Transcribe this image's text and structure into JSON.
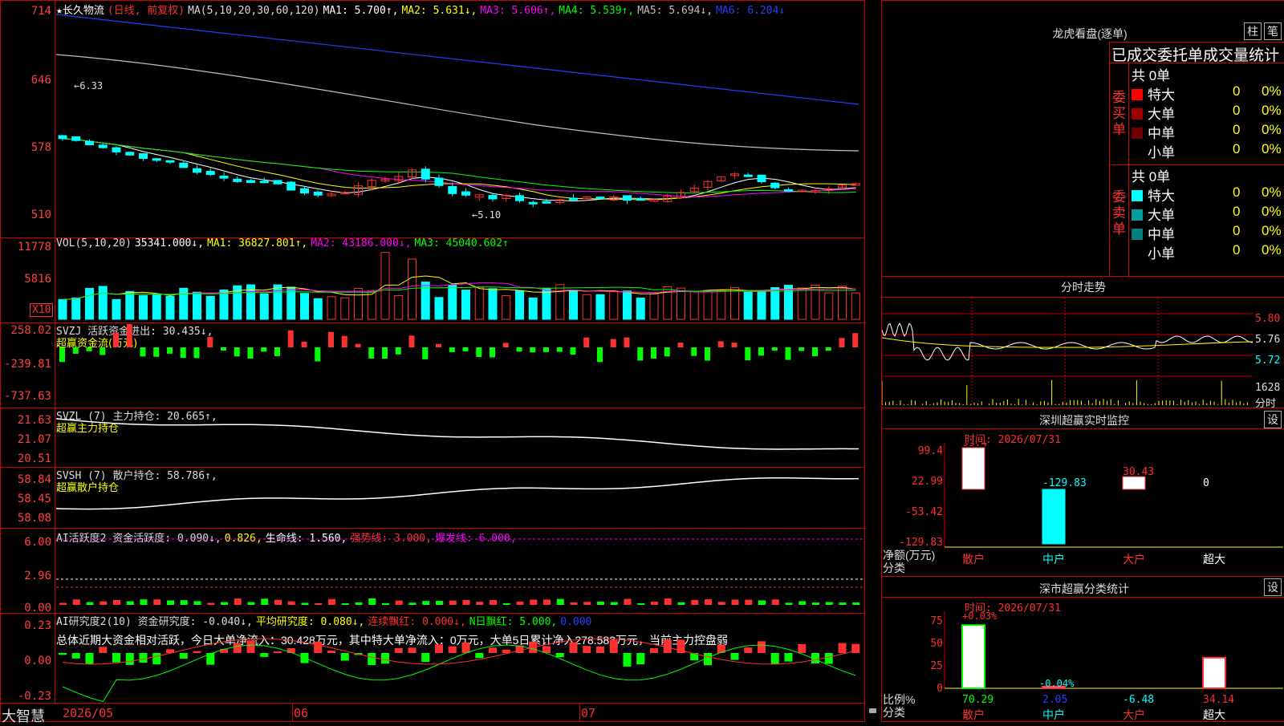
{
  "header": {
    "stock_name": "★长久物流",
    "period": "(日线, 前复权)",
    "ma_label": "MA(5,10,20,30,60,120)",
    "ma": [
      {
        "label": "MA1: 5.700↑,",
        "color": "#ffffff"
      },
      {
        "label": "MA2: 5.631↓,",
        "color": "#ffff00"
      },
      {
        "label": "MA3: 5.606↑,",
        "color": "#ff00ff"
      },
      {
        "label": "MA4: 5.539↑,",
        "color": "#00ff00"
      },
      {
        "label": "MA5: 5.694↓,",
        "color": "#c0c0c0"
      },
      {
        "label": "MA6: 6.204↓",
        "color": "#2040ff"
      }
    ],
    "ticks": [
      "714",
      "646",
      "578",
      "510"
    ],
    "high_mark": "←6.33",
    "low_mark": "←5.10",
    "colors": {
      "up": "#ff3030",
      "down": "#00ffff",
      "grid": "#c00000"
    }
  },
  "vol": {
    "legend": "VOL(5,10,20)",
    "value": "35341.000↓,",
    "ma1": "MA1: 36827.801↑,",
    "ma2": "MA2: 43186.000↓,",
    "ma3": "MA3: 45040.602↑",
    "ticks": [
      "11778",
      "5816"
    ],
    "unit": "X10"
  },
  "svzj": {
    "legend": "SVZJ  活跃资金进出: 30.435↓,",
    "sub": "超赢资金流(万元)",
    "ticks": [
      "258.02",
      "-239.81",
      "-737.63"
    ]
  },
  "svzl": {
    "legend": "SVZL (7) 主力持仓: 20.665↑,",
    "sub": "超赢主力持仓",
    "ticks": [
      "21.63",
      "21.07",
      "20.51"
    ]
  },
  "svsh": {
    "legend": "SVSH (7) 散户持仓: 58.786↑,",
    "sub": "超赢散户持仓",
    "ticks": [
      "58.84",
      "58.45",
      "58.08"
    ]
  },
  "ai2": {
    "legend_a": "AI活跃度2 资金活跃度: 0.090↓,",
    "legend_b": "0.826,",
    "legend_c": "生命线: 1.560,",
    "legend_d": "强势线: 3.000,",
    "legend_e": "爆发线: 6.000,",
    "ticks": [
      "6.00",
      "2.96",
      "0.00"
    ]
  },
  "ai_research": {
    "legend_a": "AI研究度2(10) 资金研究度: -0.040↓,",
    "legend_b": "平均研究度: 0.080↓,",
    "legend_c": "连续飘红: 0.000↓,",
    "legend_d": "N日飘红: 5.000,",
    "legend_e": "0.000",
    "summary": "总体近期大资金相对活跃，今日大单净流入：30.428万元，其中特大单净流入：0万元，大单5日累计净入278.583万元，当前主力控盘弱",
    "ticks": [
      "0.23",
      "0.00",
      "-0.23"
    ]
  },
  "footer": {
    "brand": "大智慧",
    "dates": [
      "2026/05",
      "06",
      "07"
    ]
  },
  "right": {
    "lhb_title": "龙虎看盘(逐单)",
    "btn_zhu": "柱",
    "btn_bi": "笔",
    "stat_title": "已成交委托单成交量统计",
    "buy_label": "委买单",
    "sell_label": "委卖单",
    "buy_total": "共 0单",
    "sell_total": "共 0单",
    "buy_rows": [
      {
        "name": "特大",
        "val": "0",
        "pct": "0%",
        "color": "#ff0000"
      },
      {
        "name": "大单",
        "val": "0",
        "pct": "0%",
        "color": "#a00000"
      },
      {
        "name": "中单",
        "val": "0",
        "pct": "0%",
        "color": "#700000"
      },
      {
        "name": "小单",
        "val": "0",
        "pct": "0%",
        "color": "#000000"
      }
    ],
    "sell_rows": [
      {
        "name": "特大",
        "val": "0",
        "pct": "0%",
        "color": "#00ffff"
      },
      {
        "name": "大单",
        "val": "0",
        "pct": "0%",
        "color": "#00a0a0"
      },
      {
        "name": "中单",
        "val": "0",
        "pct": "0%",
        "color": "#008080"
      },
      {
        "name": "小单",
        "val": "0",
        "pct": "0%",
        "color": "#000000"
      }
    ],
    "ft_title": "分时走势",
    "ft_ticks": [
      "5.80",
      "5.76",
      "5.72"
    ],
    "ft_vol": "1628",
    "ft_unit": "分时",
    "sz_title": "深圳超赢实时监控",
    "sz_btn": "设",
    "sz_time": "时间: 2026/07/31",
    "sz_ticks": [
      "99.4",
      "22.99",
      "-53.42",
      "-129.83"
    ],
    "sz_vals": [
      "99.4",
      "-129.83",
      "30.43",
      "0"
    ],
    "sz_ylabel": "净额(万元)",
    "sz_xlabel": "分类",
    "cats": [
      "散户",
      "中户",
      "大户",
      "超大"
    ],
    "cls_title": "深市超赢分类统计",
    "cls_btn": "设",
    "cls_time": "时间: 2026/07/31",
    "cls_ticks": [
      "75",
      "50",
      "25",
      "0"
    ],
    "cls_top": "+0.03%",
    "cls_mid": "-0.04%",
    "cls_vals": [
      "70.29",
      "2.05",
      "-6.48",
      "34.14"
    ],
    "cls_ylabel": "比例%",
    "cls_xlabel": "分类"
  }
}
